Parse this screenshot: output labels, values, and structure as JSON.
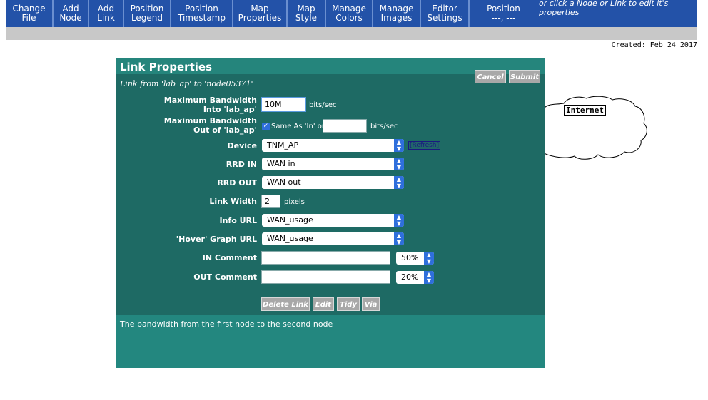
{
  "toolbar": {
    "buttons": [
      {
        "line1": "Change",
        "line2": "File"
      },
      {
        "line1": "Add",
        "line2": "Node"
      },
      {
        "line1": "Add",
        "line2": "Link"
      },
      {
        "line1": "Position",
        "line2": "Legend"
      },
      {
        "line1": "Position",
        "line2": "Timestamp"
      },
      {
        "line1": "Map",
        "line2": "Properties"
      },
      {
        "line1": "Map",
        "line2": "Style"
      },
      {
        "line1": "Manage",
        "line2": "Colors"
      },
      {
        "line1": "Manage",
        "line2": "Images"
      },
      {
        "line1": "Editor",
        "line2": "Settings"
      }
    ],
    "position": {
      "label": "Position",
      "value": "---, ---"
    },
    "message": "or click a Node or Link to edit it's properties"
  },
  "created": "Created: Feb 24 2017",
  "dialog": {
    "title": "Link Properties",
    "subtitle": "Link from 'lab_ap' to 'node05371'",
    "cancel_label": "Cancel",
    "submit_label": "Submit",
    "bw_in": {
      "label1": "Maximum Bandwidth",
      "label2": "Into 'lab_ap'",
      "value": "10M",
      "unit": "bits/sec"
    },
    "bw_out": {
      "label1": "Maximum Bandwidth",
      "label2": "Out of 'lab_ap'",
      "checkbox_label": "Same As 'In' or",
      "value": "",
      "unit": "bits/sec"
    },
    "device": {
      "label": "Device",
      "value": "TNM_AP",
      "refresh": "[Refresh]"
    },
    "rrd_in": {
      "label": "RRD IN",
      "value": "WAN in"
    },
    "rrd_out": {
      "label": "RRD OUT",
      "value": "WAN out"
    },
    "link_width": {
      "label": "Link Width",
      "value": "2",
      "unit": "pixels"
    },
    "info_url": {
      "label": "Info URL",
      "value": "WAN_usage"
    },
    "hover_url": {
      "label": "'Hover' Graph URL",
      "value": "WAN_usage"
    },
    "in_comment": {
      "label": "IN Comment",
      "value": "",
      "pos": "50%"
    },
    "out_comment": {
      "label": "OUT Comment",
      "value": "",
      "pos": "20%"
    },
    "actions": {
      "delete": "Delete Link",
      "edit": "Edit",
      "tidy": "Tidy",
      "via": "Via"
    },
    "help": "The bandwidth from the first node to the second node"
  },
  "map": {
    "node_label": "Internet"
  }
}
